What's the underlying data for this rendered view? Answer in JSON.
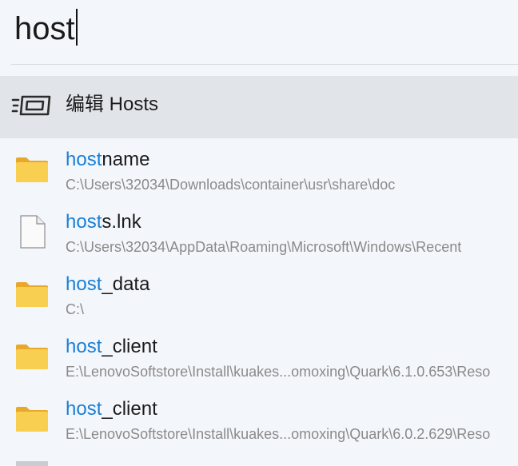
{
  "search": {
    "query": "host"
  },
  "command": {
    "label": "编辑 Hosts",
    "icon": "hosts-edit-icon"
  },
  "results": [
    {
      "match": "host",
      "rest": "name",
      "path": "C:\\Users\\32034\\Downloads\\container\\usr\\share\\doc",
      "icon": "folder-icon"
    },
    {
      "match": "host",
      "rest": "s.lnk",
      "path": "C:\\Users\\32034\\AppData\\Roaming\\Microsoft\\Windows\\Recent",
      "icon": "file-icon"
    },
    {
      "match": "host",
      "rest": "_data",
      "path": "C:\\",
      "icon": "folder-icon"
    },
    {
      "match": "host",
      "rest": "_client",
      "path": "E:\\LenovoSoftstore\\Install\\kuakes...omoxing\\Quark\\6.1.0.653\\Reso",
      "icon": "folder-icon"
    },
    {
      "match": "host",
      "rest": "_client",
      "path": "E:\\LenovoSoftstore\\Install\\kuakes...omoxing\\Quark\\6.0.2.629\\Reso",
      "icon": "folder-icon"
    }
  ],
  "colors": {
    "highlight": "#1a7fd4",
    "selected_bg": "#e1e5ea",
    "folder": "#f7c744"
  }
}
